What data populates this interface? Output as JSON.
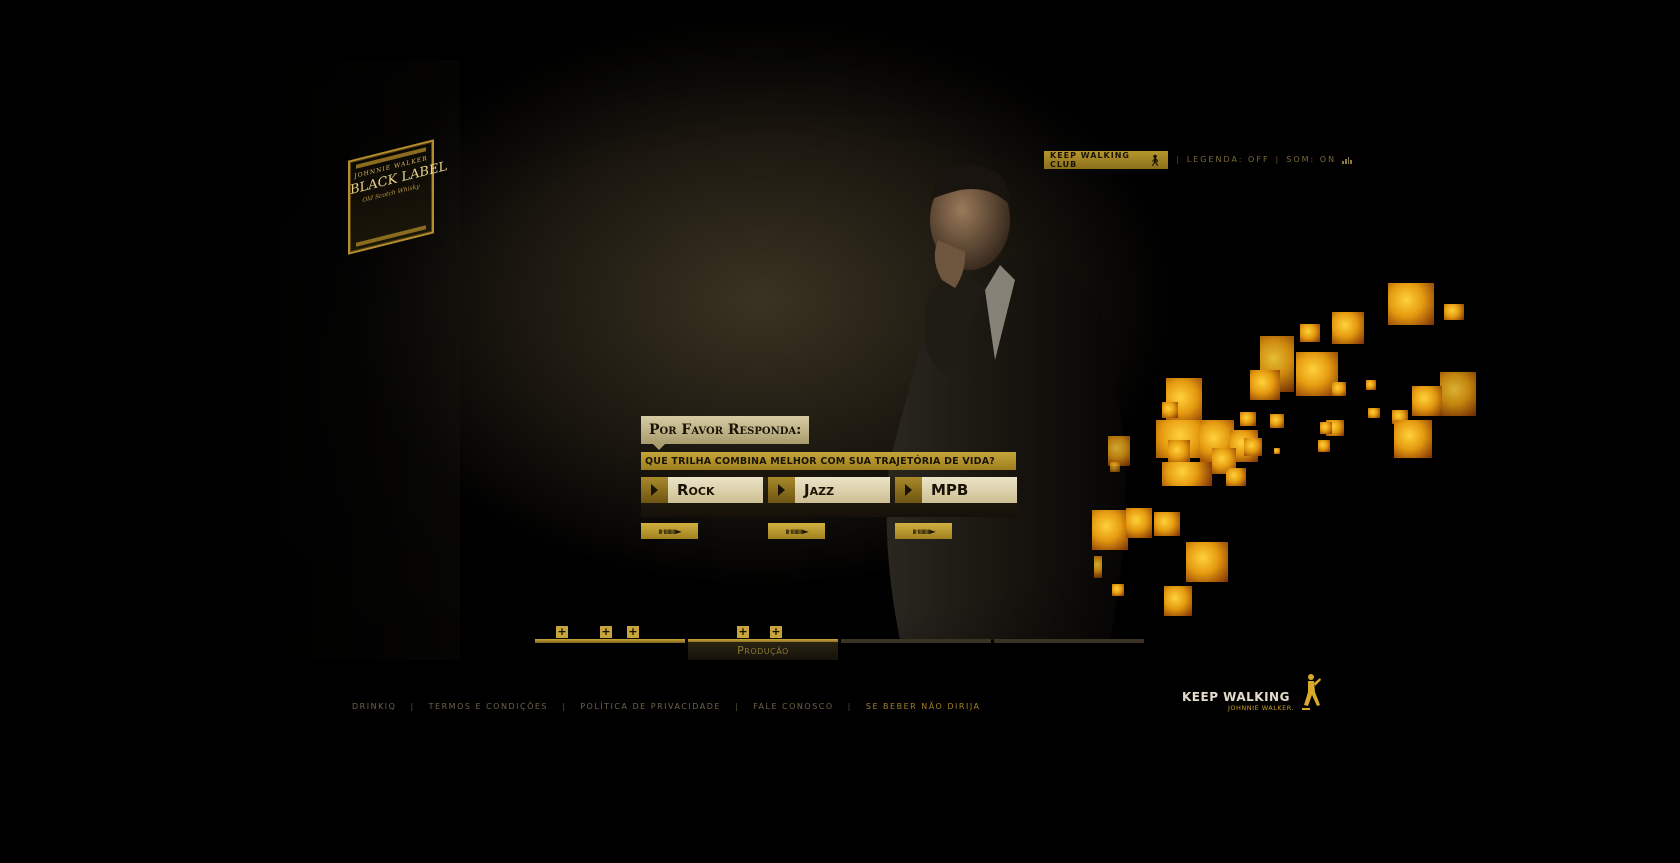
{
  "logo": {
    "top": "JOHNNIE WALKER",
    "main": "BLACK LABEL",
    "sub": "Old Scotch Whisky"
  },
  "header": {
    "club_label": "KEEP WALKING CLUB",
    "legenda": "LEGENDA: OFF",
    "som": "SOM: ON",
    "separator": "|"
  },
  "quiz": {
    "title": "Por Favor Responda:",
    "question": "QUE TRILHA COMBINA MELHOR COM SUA TRAJETÓRIA DE VIDA?",
    "answers": [
      {
        "label": "Rock"
      },
      {
        "label": "Jazz"
      },
      {
        "label": "MPB"
      }
    ],
    "go_label": "ııı·ıııııııııı►"
  },
  "progress": {
    "marker_symbol": "+",
    "current_stage": "Produção",
    "filled_segments": 2,
    "total_segments": 4
  },
  "footer": {
    "links": [
      "DRINKIQ",
      "TERMOS E CONDIÇÕES",
      "POLÍTICA DE PRIVACIDADE",
      "FALE CONOSCO",
      "SE BEBER NÃO DIRIJA"
    ],
    "separator": "|"
  },
  "brand": {
    "tagline": "KEEP WALKING",
    "name": "JOHNNIE WALKER."
  },
  "colors": {
    "gold": "#c8a43d",
    "dark_gold": "#8a6f1c",
    "background": "#000000",
    "cream": "#ece4c8"
  }
}
